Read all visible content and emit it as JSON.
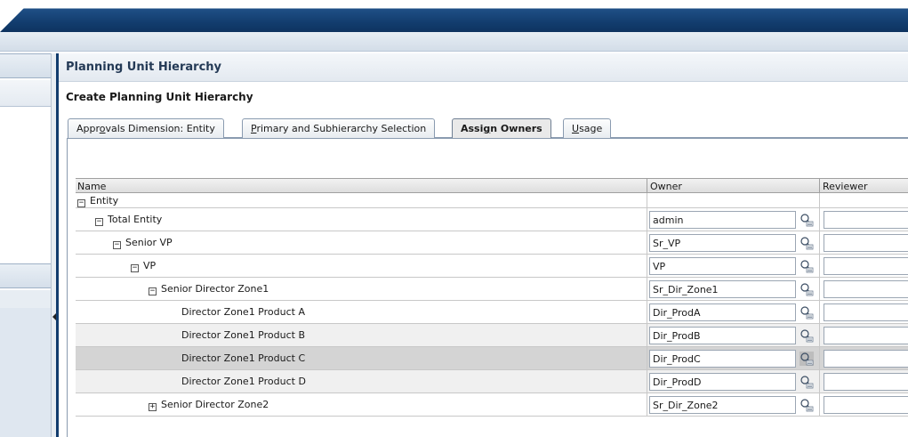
{
  "page": {
    "title": "Planning Unit Hierarchy",
    "subtitle": "Create Planning Unit Hierarchy"
  },
  "tabs": [
    {
      "pre": "Appr",
      "key": "o",
      "post": "vals Dimension: Entity",
      "active": false
    },
    {
      "pre": "",
      "key": "P",
      "post": "rimary and Subhierarchy Selection",
      "active": false
    },
    {
      "pre": "Assi",
      "key": "g",
      "post": "n Owners",
      "active": true
    },
    {
      "pre": "",
      "key": "U",
      "post": "sage",
      "active": false
    }
  ],
  "table": {
    "columns": {
      "name": "Name",
      "owner": "Owner",
      "reviewer": "Reviewer"
    },
    "rows": [
      {
        "name": "Entity",
        "expander": "−",
        "level": 0,
        "owner": null
      },
      {
        "name": "Total Entity",
        "expander": "−",
        "level": 1,
        "owner": "admin"
      },
      {
        "name": "Senior VP",
        "expander": "−",
        "level": 2,
        "owner": "Sr_VP"
      },
      {
        "name": "VP",
        "expander": "−",
        "level": 3,
        "owner": "VP"
      },
      {
        "name": "Senior Director Zone1",
        "expander": "−",
        "level": 4,
        "owner": "Sr_Dir_Zone1"
      },
      {
        "name": "Director Zone1 Product A",
        "expander": "",
        "level": 5,
        "owner": "Dir_ProdA"
      },
      {
        "name": "Director Zone1 Product B",
        "expander": "",
        "level": 5,
        "owner": "Dir_ProdB"
      },
      {
        "name": "Director Zone1 Product C",
        "expander": "",
        "level": 5,
        "owner": "Dir_ProdC",
        "selected": true
      },
      {
        "name": "Director Zone1 Product D",
        "expander": "",
        "level": 5,
        "owner": "Dir_ProdD"
      },
      {
        "name": "Senior Director Zone2",
        "expander": "+",
        "level": 4,
        "owner": "Sr_Dir_Zone2"
      }
    ]
  },
  "icons": {
    "user_picker": "user-search-icon"
  },
  "colors": {
    "banner": "#123c6d",
    "selected_row": "#d4d4d4",
    "alt_row": "#f0f0f0"
  }
}
